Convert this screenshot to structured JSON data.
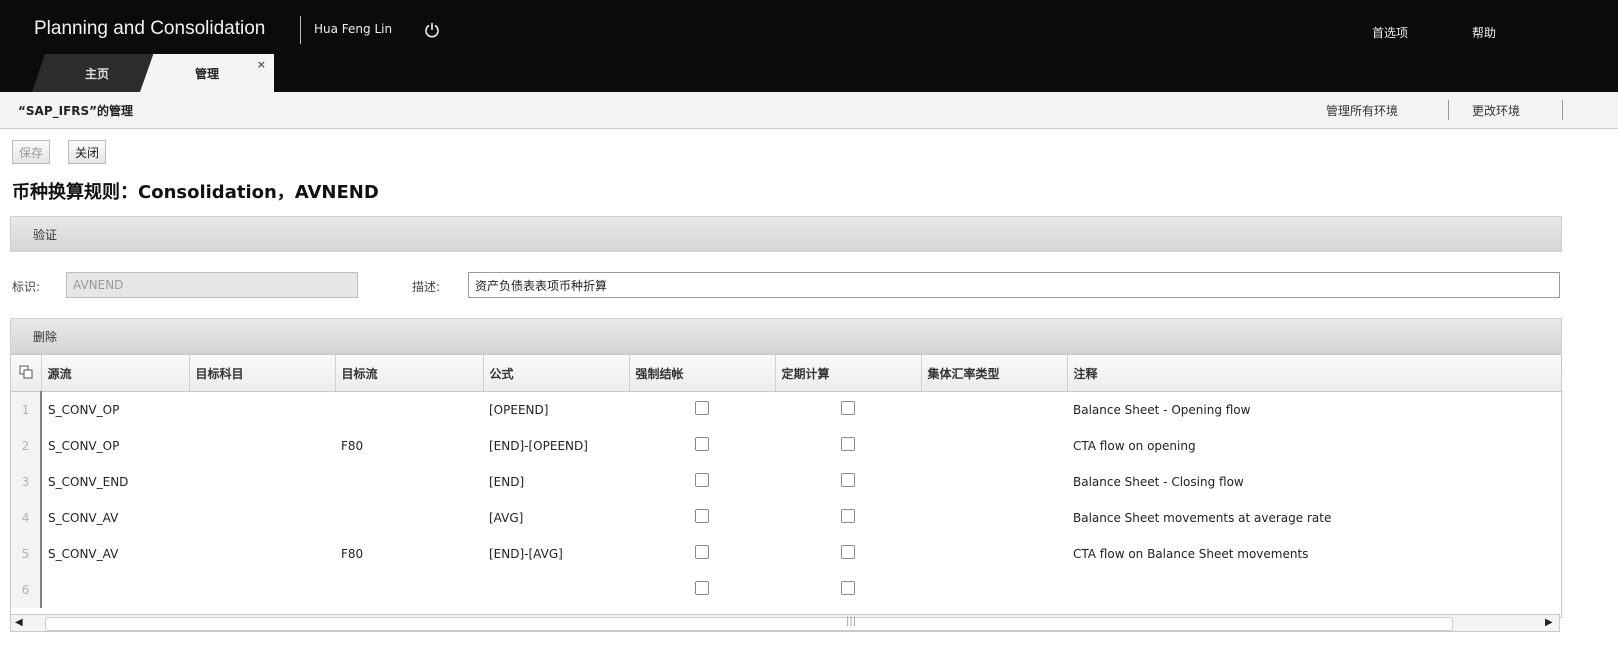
{
  "app": {
    "title": "Planning and Consolidation",
    "user": "Hua Feng Lin",
    "preferences": "首选项",
    "help": "帮助"
  },
  "tabs": [
    {
      "label": "主页"
    },
    {
      "label": "管理",
      "close": "×"
    }
  ],
  "subheader": {
    "title": "“SAP_IFRS”的管理",
    "manage_all": "管理所有环境",
    "change_env": "更改环境"
  },
  "toolbar": {
    "save": "保存",
    "close": "关闭"
  },
  "page_title": "币种换算规则：Consolidation，AVNEND",
  "sections": {
    "validate": "验证",
    "delete": "删除"
  },
  "form": {
    "id_label": "标识:",
    "id_value": "AVNEND",
    "desc_label": "描述:",
    "desc_value": "资产负债表表项币种折算"
  },
  "grid": {
    "columns": [
      "源流",
      "目标科目",
      "目标流",
      "公式",
      "强制结帐",
      "定期计算",
      "集体汇率类型",
      "注释"
    ],
    "rows": [
      {
        "num": "1",
        "source": "S_CONV_OP",
        "target_acct": "",
        "target_flow": "",
        "formula": "[OPEEND]",
        "comment": "Balance Sheet - Opening flow"
      },
      {
        "num": "2",
        "source": "S_CONV_OP",
        "target_acct": "",
        "target_flow": "F80",
        "formula": "[END]-[OPEEND]",
        "comment": "CTA flow on opening"
      },
      {
        "num": "3",
        "source": "S_CONV_END",
        "target_acct": "",
        "target_flow": "",
        "formula": "[END]",
        "comment": "Balance Sheet - Closing flow"
      },
      {
        "num": "4",
        "source": "S_CONV_AV",
        "target_acct": "",
        "target_flow": "",
        "formula": "[AVG]",
        "comment": "Balance Sheet movements at average rate"
      },
      {
        "num": "5",
        "source": "S_CONV_AV",
        "target_acct": "",
        "target_flow": "F80",
        "formula": "[END]-[AVG]",
        "comment": "CTA flow on Balance Sheet movements"
      },
      {
        "num": "6",
        "source": "",
        "target_acct": "",
        "target_flow": "",
        "formula": "",
        "comment": ""
      }
    ]
  },
  "scrollbar": {
    "left": "◀",
    "right": "▶",
    "grip": "|||"
  }
}
